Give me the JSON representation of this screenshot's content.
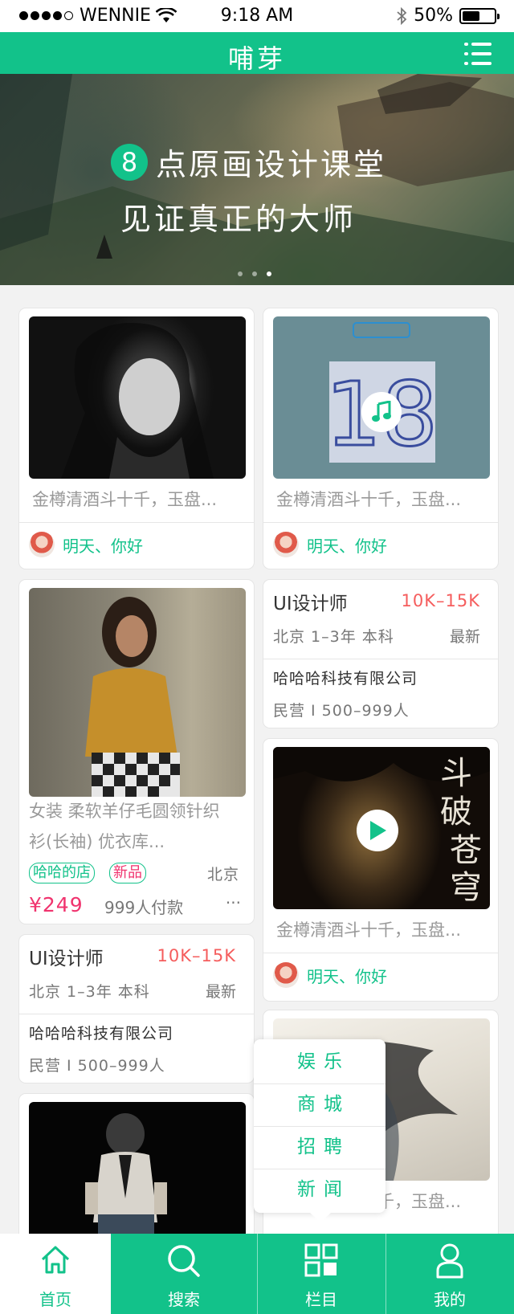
{
  "status_bar": {
    "carrier": "WENNIE",
    "time": "9:18 AM",
    "battery": "50%"
  },
  "header": {
    "title": "哺芽"
  },
  "banner": {
    "number": "8",
    "line1": "点原画设计课堂",
    "line2": "见证真正的大师",
    "indicator_count": 3,
    "active_index": 2
  },
  "feed": {
    "post_caption": "金樽清酒斗十千，玉盘...",
    "author_name": "明天、你好",
    "job": {
      "title": "UI设计师",
      "salary": "10K–15K",
      "meta": "北京  1–3年  本科",
      "badge": "最新",
      "company": "哈哈哈科技有限公司",
      "company_meta": "民营 I 500–999人"
    },
    "product": {
      "title_line1": "女装 柔软羊仔毛圆领针织",
      "title_line2": "衫(长袖) 优衣库...",
      "tag_shop": "哈哈的店",
      "tag_new": "新品",
      "location": "北京",
      "price": "¥249",
      "buyers": "999人付款",
      "more": "···"
    }
  },
  "dropdown": {
    "items": [
      "娱乐",
      "商城",
      "招聘",
      "新闻"
    ]
  },
  "tabbar": {
    "tabs": [
      {
        "label": "首页",
        "icon": "home-icon"
      },
      {
        "label": "搜索",
        "icon": "search-icon"
      },
      {
        "label": "栏目",
        "icon": "grid-icon"
      },
      {
        "label": "我的",
        "icon": "user-icon"
      }
    ],
    "active_index": 0
  },
  "colors": {
    "accent": "#12c28a",
    "price": "#f0336e",
    "salary": "#f55d5d"
  }
}
